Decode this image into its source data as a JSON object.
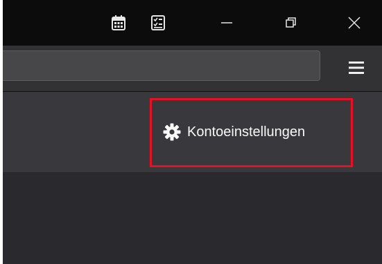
{
  "titlebar": {
    "buttons": [
      {
        "icon": "calendar-icon"
      },
      {
        "icon": "tasks-icon"
      },
      {
        "icon": "minimize-icon"
      },
      {
        "icon": "restore-icon"
      },
      {
        "icon": "close-icon"
      }
    ]
  },
  "toolbar": {
    "url": "",
    "menu_icon": "hamburger-menu-icon"
  },
  "content": {
    "account_settings_label": "Kontoeinstellungen",
    "account_settings_icon": "gear-icon"
  },
  "colors": {
    "titlebar_bg": "#0c0c0d",
    "toolbar_bg": "#323234",
    "urlbar_bg": "#474749",
    "header_bg": "#38383d",
    "body_bg": "#2a2a2e",
    "text": "#f9f9fa",
    "highlight": "#e81123"
  }
}
